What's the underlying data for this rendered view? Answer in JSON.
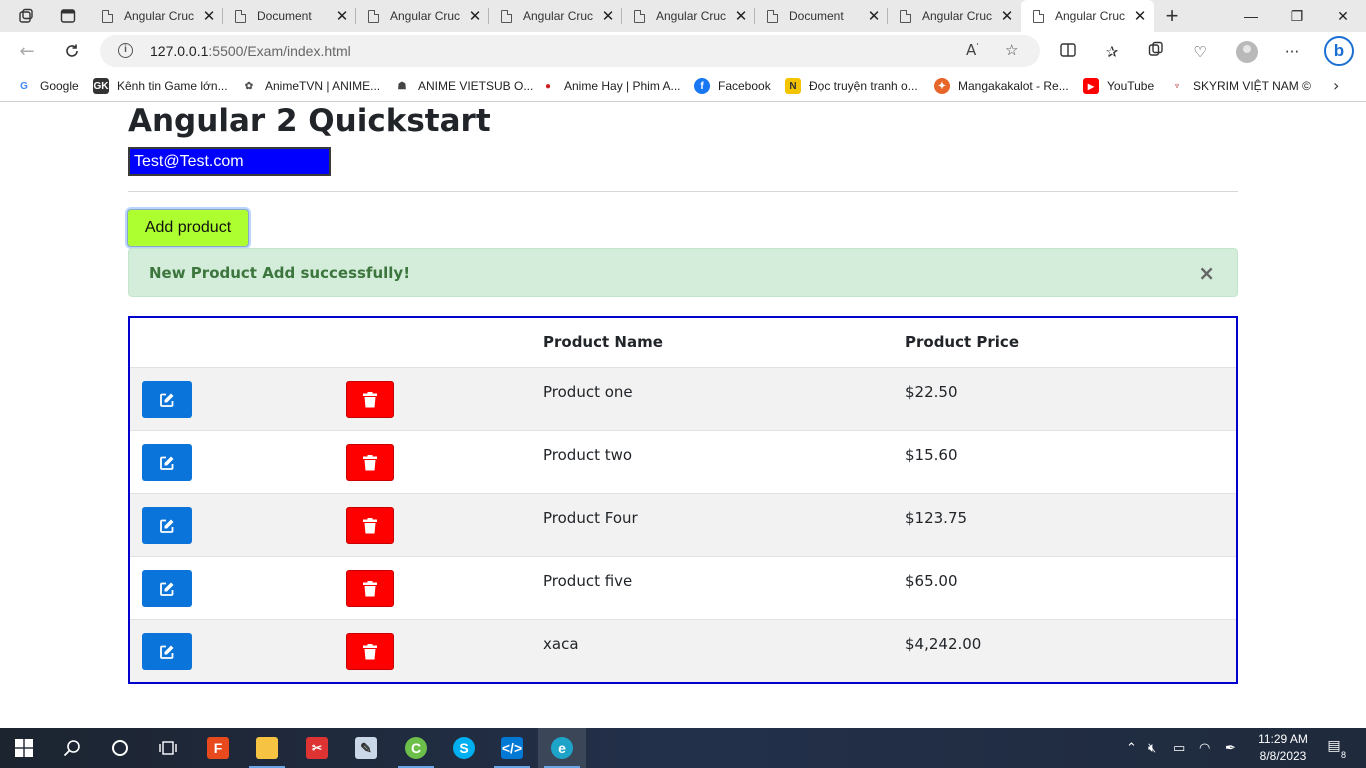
{
  "browser": {
    "tabs": [
      {
        "label": "Angular Cruc",
        "active": false
      },
      {
        "label": "Document",
        "active": false
      },
      {
        "label": "Angular Cruc",
        "active": false
      },
      {
        "label": "Angular Cruc",
        "active": false
      },
      {
        "label": "Angular Cruc",
        "active": false
      },
      {
        "label": "Document",
        "active": false
      },
      {
        "label": "Angular Cruc",
        "active": false
      },
      {
        "label": "Angular Cruc",
        "active": true
      }
    ],
    "new_tab": "+",
    "window_controls": {
      "minimize": "—",
      "maximize": "❐",
      "close": "✕"
    },
    "url_host": "127.0.0.1",
    "url_path": ":5500/Exam/index.html",
    "favorites": [
      {
        "label": "Google",
        "icon": "google-icon",
        "color": "#4285f4"
      },
      {
        "label": "Kênh tin Game lớn...",
        "icon": "gk-icon",
        "color": "#333333"
      },
      {
        "label": "AnimeTVN | ANIME...",
        "icon": "animetvn-icon",
        "color": "#555555"
      },
      {
        "label": "ANIME VIETSUB O...",
        "icon": "anime-vietsub-icon",
        "color": "#444444"
      },
      {
        "label": "Anime Hay | Phim A...",
        "icon": "animehay-icon",
        "color": "#cc2222"
      },
      {
        "label": "Facebook",
        "icon": "facebook-icon",
        "color": "#1877f2"
      },
      {
        "label": "Đọc truyện tranh o...",
        "icon": "nettruyen-icon",
        "color": "#f5c400"
      },
      {
        "label": "Mangakakalot - Re...",
        "icon": "mangakakalot-icon",
        "color": "#e8652a"
      },
      {
        "label": "YouTube",
        "icon": "youtube-icon",
        "color": "#ff0000"
      },
      {
        "label": "SKYRIM VIỆT NAM ©",
        "icon": "skyrim-icon",
        "color": "#aa2222"
      }
    ]
  },
  "page": {
    "title": "Angular 2 Quickstart",
    "email_value": "Test@Test.com",
    "add_button": "Add product",
    "alert_message": "New Product Add successfully!",
    "alert_close": "×",
    "table": {
      "headers": [
        "",
        "",
        "Product Name",
        "Product Price"
      ],
      "rows": [
        {
          "name": "Product one",
          "price": "$22.50"
        },
        {
          "name": "Product two",
          "price": "$15.60"
        },
        {
          "name": "Product Four",
          "price": "$123.75"
        },
        {
          "name": "Product five",
          "price": "$65.00"
        },
        {
          "name": "xaca",
          "price": "$4,242.00"
        }
      ]
    }
  },
  "taskbar": {
    "time": "11:29 AM",
    "date": "8/8/2023",
    "notifications": "8"
  },
  "colors": {
    "email_bg": "#0000ff",
    "add_button_bg": "#adff2f",
    "alert_bg": "#d4edda",
    "alert_text": "#3c763d",
    "table_border": "#0000cc",
    "edit_button": "#0a74da",
    "delete_button": "#ff0000"
  }
}
